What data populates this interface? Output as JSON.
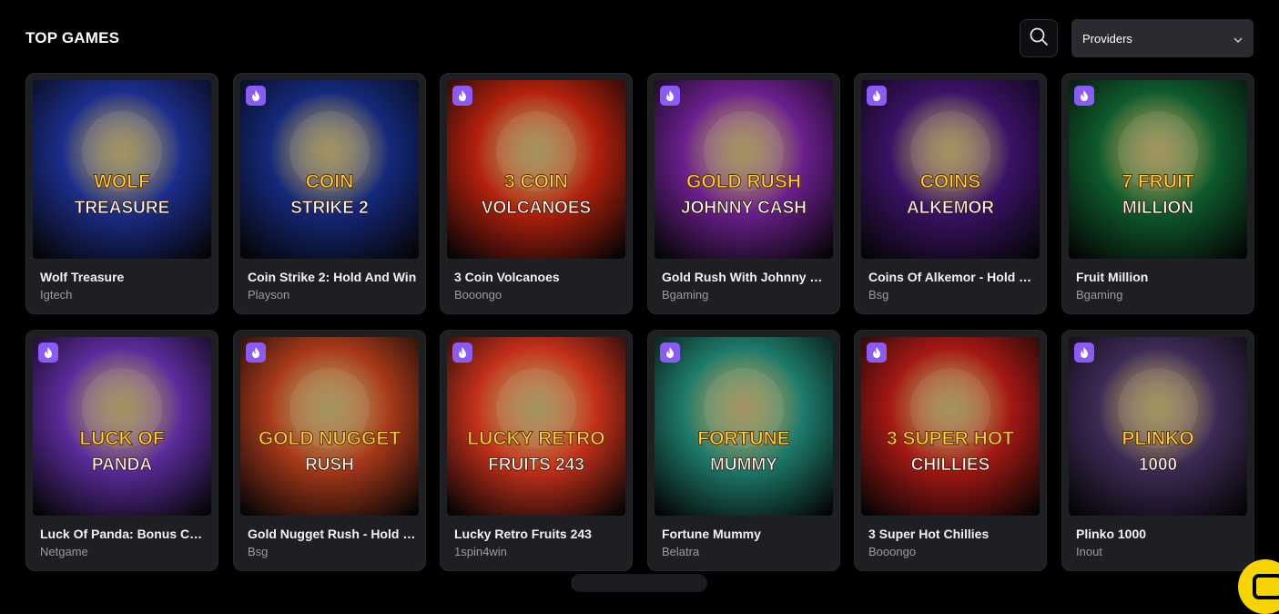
{
  "section": {
    "title": "TOP GAMES"
  },
  "providers_select": {
    "selected": "Providers"
  },
  "colors": {
    "background": "#000000",
    "card": "#1e1f23",
    "badge": "#8a5cf5",
    "chat_button": "#f5d400"
  },
  "games": [
    {
      "name": "Wolf Treasure",
      "provider": "Igtech",
      "hot": false,
      "art": [
        "WOLF",
        "TREASURE"
      ],
      "theme": "#1b2d8a"
    },
    {
      "name": "Coin Strike 2: Hold And Win",
      "provider": "Playson",
      "hot": true,
      "art": [
        "COIN",
        "STRIKE 2"
      ],
      "theme": "#14287a"
    },
    {
      "name": "3 Coin Volcanoes",
      "provider": "Booongo",
      "hot": true,
      "art": [
        "3 COIN",
        "VOLCANOES"
      ],
      "theme": "#b2200d"
    },
    {
      "name": "Gold Rush With Johnny Cash",
      "provider": "Bgaming",
      "hot": true,
      "art": [
        "GOLD RUSH",
        "JOHNNY CASH"
      ],
      "theme": "#6a1f8d"
    },
    {
      "name": "Coins Of Alkemor - Hold & Win",
      "provider": "Bsg",
      "hot": true,
      "art": [
        "COINS",
        "ALKEMOR"
      ],
      "theme": "#3a1266"
    },
    {
      "name": "Fruit Million",
      "provider": "Bgaming",
      "hot": true,
      "art": [
        "7 FRUIT",
        "MILLION"
      ],
      "theme": "#0e5a2c"
    },
    {
      "name": "Luck Of Panda: Bonus Combo",
      "provider": "Netgame",
      "hot": true,
      "art": [
        "LUCK OF",
        "PANDA"
      ],
      "theme": "#5b2b9b"
    },
    {
      "name": "Gold Nugget Rush - Hold & Win",
      "provider": "Bsg",
      "hot": true,
      "art": [
        "GOLD NUGGET",
        "RUSH"
      ],
      "theme": "#a8391a"
    },
    {
      "name": "Lucky Retro Fruits 243",
      "provider": "1spin4win",
      "hot": true,
      "art": [
        "LUCKY RETRO",
        "FRUITS 243"
      ],
      "theme": "#c4301a"
    },
    {
      "name": "Fortune Mummy",
      "provider": "Belatra",
      "hot": true,
      "art": [
        "FORTUNE",
        "MUMMY"
      ],
      "theme": "#1d7a6b"
    },
    {
      "name": "3 Super Hot Chillies",
      "provider": "Booongo",
      "hot": true,
      "art": [
        "3 SUPER HOT",
        "CHILLIES"
      ],
      "theme": "#a51814"
    },
    {
      "name": "Plinko 1000",
      "provider": "Inout",
      "hot": true,
      "art": [
        "PLINKO",
        "1000"
      ],
      "theme": "#3d2a55"
    }
  ]
}
